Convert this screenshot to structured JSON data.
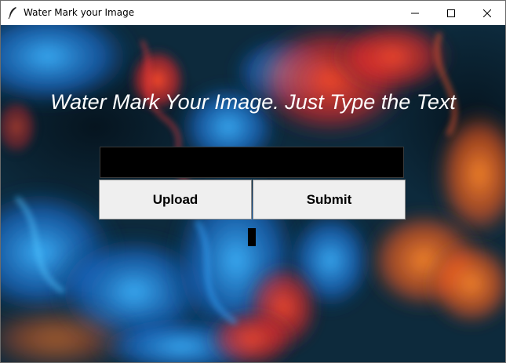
{
  "window": {
    "title": "Water Mark your Image",
    "app_icon": "feather-icon",
    "controls": [
      "minimize-icon",
      "maximize-icon",
      "close-icon"
    ]
  },
  "main": {
    "headline": "Water Mark Your Image. Just Type the Text",
    "watermark_text_value": "",
    "upload_label": "Upload",
    "submit_label": "Submit",
    "status_text": ""
  },
  "colors": {
    "headline_text": "#ffffff",
    "entry_background": "#000000",
    "button_background": "#efefef",
    "background_dominant": "#0b2434",
    "smoke_blue": "#1e90ff",
    "smoke_red": "#ff3b1f",
    "smoke_orange": "#ff7a1a"
  }
}
